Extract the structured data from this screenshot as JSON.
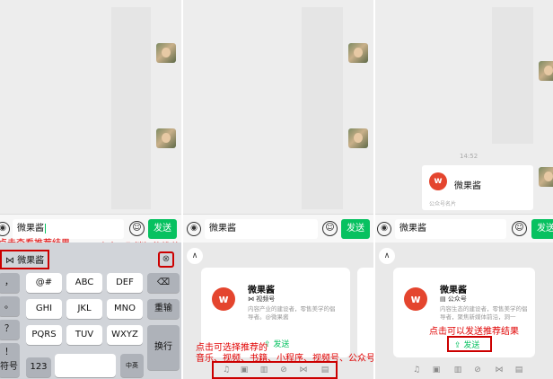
{
  "panel1": {
    "input_text": "微果酱",
    "send_label": "发送",
    "suggestion": "微果酱",
    "annotation_view": "点击查看推荐结果",
    "annotation_cancel": "点击可取消智能推荐",
    "keys": {
      "row1": [
        "，",
        "@#",
        "ABC",
        "DEF"
      ],
      "row2": [
        "。",
        "GHI",
        "JKL",
        "MNO"
      ],
      "row3": [
        "？",
        "PQRS",
        "TUV",
        "WXYZ"
      ],
      "row4": [
        "！"
      ],
      "left_bottom": "符号",
      "num": "123",
      "lang": "中英",
      "backspace": "⌫",
      "reenter": "重输",
      "enter": "换行"
    }
  },
  "panel2": {
    "input_text": "微果酱",
    "send_label": "发送",
    "card": {
      "name": "微果酱",
      "type": "视频号",
      "desc": "内容产业的建设者，零售美学的倡导者。@微果酱",
      "send": "发送"
    },
    "annotation": "点击可选择推荐的",
    "annotation_line2": "音乐、视频、书籍、小程序、视频号、公众号"
  },
  "panel3": {
    "input_text": "微果酱",
    "send_label": "发送",
    "time": "14:52",
    "sent_card": {
      "name": "微果酱",
      "footer": "公众号名片"
    },
    "card": {
      "name": "微果酱",
      "type": "公众号",
      "desc": "内容生态的建设者，零售美学的倡导者，聚焦新媒体前沿，洞一",
      "send": "发送"
    },
    "annotation": "点击可以发送推荐结果"
  },
  "colors": {
    "accent": "#07c160",
    "annotation": "#e00000",
    "brand": "#e4452e"
  }
}
